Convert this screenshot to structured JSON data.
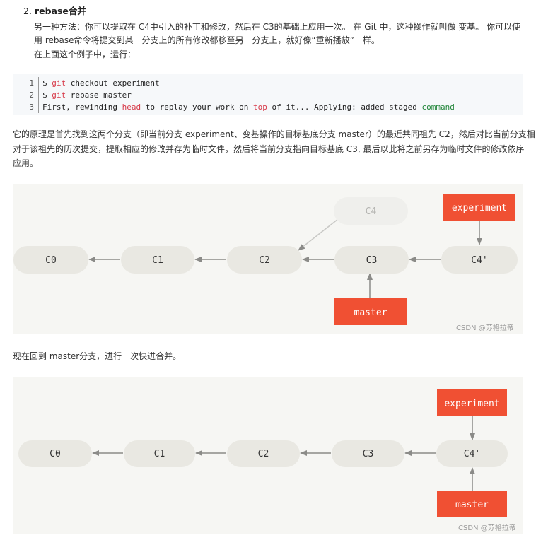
{
  "section": {
    "number": "2.",
    "title": "rebase合并",
    "intro_line1": "另一种方法：你可以提取在 C4中引入的补丁和修改，然后在 C3的基础上应用一次。 在 Git 中，这种操作就叫做 变基。 你可以使",
    "intro_line2": "用 rebase命令将提交到某一分支上的所有修改都移至另一分支上，就好像“重新播放”一样。",
    "intro_line3": "在上面这个例子中，运行："
  },
  "code": {
    "lines": [
      {
        "num": "1",
        "prompt": "$ ",
        "git": "git",
        "rest": " checkout experiment"
      },
      {
        "num": "2",
        "prompt": "$ ",
        "git": "git",
        "rest": " rebase master"
      },
      {
        "num": "3",
        "p1": "First, rewinding ",
        "head": "head",
        "p2": " to replay your work on ",
        "top": "top",
        "p3": " of it... Applying: added staged ",
        "command": "command"
      }
    ]
  },
  "principle": {
    "line1": "它的原理是首先找到这两个分支（即当前分支 experiment、变基操作的目标基底分支 master）的最近共同祖先 C2，然后对比当前分支相",
    "line2": "对于该祖先的历次提交，提取相应的修改并存为临时文件，然后将当前分支指向目标基底 C3, 最后以此将之前另存为临时文件的修改依序",
    "line3": "应用。"
  },
  "diagram1": {
    "commits": [
      "C0",
      "C1",
      "C2",
      "C3",
      "C4'"
    ],
    "old_commit": "C4",
    "branch_top": "experiment",
    "branch_bottom": "master",
    "watermark": "CSDN @苏格拉帝"
  },
  "ff_text": "现在回到 master分支，进行一次快进合并。",
  "diagram2": {
    "commits": [
      "C0",
      "C1",
      "C2",
      "C3",
      "C4'"
    ],
    "branch_top": "experiment",
    "branch_bottom": "master",
    "watermark": "CSDN @苏格拉帝"
  },
  "colors": {
    "branch_label": "#f05033",
    "commit_pill": "#e9e8e2",
    "ghost_pill": "#efefec",
    "arrow": "#8b8b88",
    "diagram_bg": "#f6f6f3",
    "keyword": "#d73a49",
    "command": "#22863a"
  }
}
